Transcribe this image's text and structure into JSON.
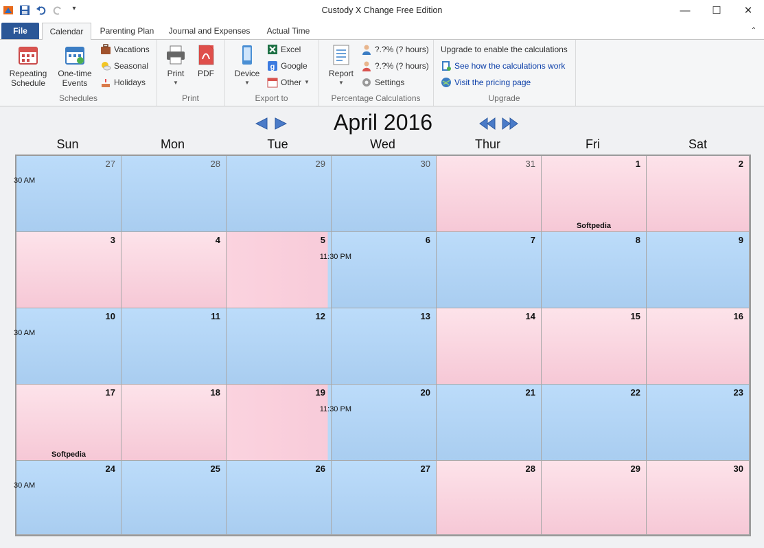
{
  "window": {
    "title": "Custody X Change Free Edition"
  },
  "tabs": [
    {
      "label": "File"
    },
    {
      "label": "Calendar"
    },
    {
      "label": "Parenting Plan"
    },
    {
      "label": "Journal and Expenses"
    },
    {
      "label": "Actual Time"
    }
  ],
  "ribbon": {
    "schedules": {
      "label": "Schedules",
      "repeating": "Repeating\nSchedule",
      "onetime": "One-time\nEvents",
      "vacations": "Vacations",
      "seasonal": "Seasonal",
      "holidays": "Holidays"
    },
    "print": {
      "label": "Print",
      "print": "Print",
      "pdf": "PDF"
    },
    "export": {
      "label": "Export to",
      "device": "Device",
      "excel": "Excel",
      "google": "Google",
      "other": "Other"
    },
    "percentage": {
      "label": "Percentage Calculations",
      "report": "Report",
      "pct1": "?.?% (? hours)",
      "pct2": "?.?% (? hours)",
      "settings": "Settings"
    },
    "upgrade": {
      "label": "Upgrade",
      "notice": "Upgrade to enable the calculations",
      "link1": "See how the calculations work",
      "link2": "Visit the pricing page"
    }
  },
  "calendar": {
    "month": "April 2016",
    "daynames": [
      "Sun",
      "Mon",
      "Tue",
      "Wed",
      "Thur",
      "Fri",
      "Sat"
    ],
    "weeks": [
      [
        {
          "d": "27",
          "c": "blue",
          "dim": true
        },
        {
          "d": "28",
          "c": "blue",
          "dim": true
        },
        {
          "d": "29",
          "c": "blue",
          "dim": true
        },
        {
          "d": "30",
          "c": "blue",
          "dim": true
        },
        {
          "d": "31",
          "c": "pink",
          "dim": true
        },
        {
          "d": "1",
          "c": "pink",
          "evt": "Softpedia"
        },
        {
          "d": "2",
          "c": "pink"
        }
      ],
      [
        {
          "d": "3",
          "c": "pink"
        },
        {
          "d": "4",
          "c": "pink"
        },
        {
          "d": "5",
          "c": "pink",
          "half": true
        },
        {
          "d": "6",
          "c": "blue"
        },
        {
          "d": "7",
          "c": "blue"
        },
        {
          "d": "8",
          "c": "blue"
        },
        {
          "d": "9",
          "c": "blue"
        }
      ],
      [
        {
          "d": "10",
          "c": "blue"
        },
        {
          "d": "11",
          "c": "blue"
        },
        {
          "d": "12",
          "c": "blue"
        },
        {
          "d": "13",
          "c": "blue"
        },
        {
          "d": "14",
          "c": "pink"
        },
        {
          "d": "15",
          "c": "pink"
        },
        {
          "d": "16",
          "c": "pink"
        }
      ],
      [
        {
          "d": "17",
          "c": "pink",
          "evt": "Softpedia"
        },
        {
          "d": "18",
          "c": "pink"
        },
        {
          "d": "19",
          "c": "pink",
          "half": true
        },
        {
          "d": "20",
          "c": "blue"
        },
        {
          "d": "21",
          "c": "blue"
        },
        {
          "d": "22",
          "c": "blue"
        },
        {
          "d": "23",
          "c": "blue"
        }
      ],
      [
        {
          "d": "24",
          "c": "blue"
        },
        {
          "d": "25",
          "c": "blue"
        },
        {
          "d": "26",
          "c": "blue"
        },
        {
          "d": "27",
          "c": "blue"
        },
        {
          "d": "28",
          "c": "pink"
        },
        {
          "d": "29",
          "c": "pink"
        },
        {
          "d": "30",
          "c": "pink"
        }
      ]
    ],
    "time_am": "30 AM",
    "time_pm": "11:30 PM"
  },
  "colors": {
    "blue": "#b3d5f6",
    "pink": "#fbd3df",
    "accent": "#2b5797"
  }
}
